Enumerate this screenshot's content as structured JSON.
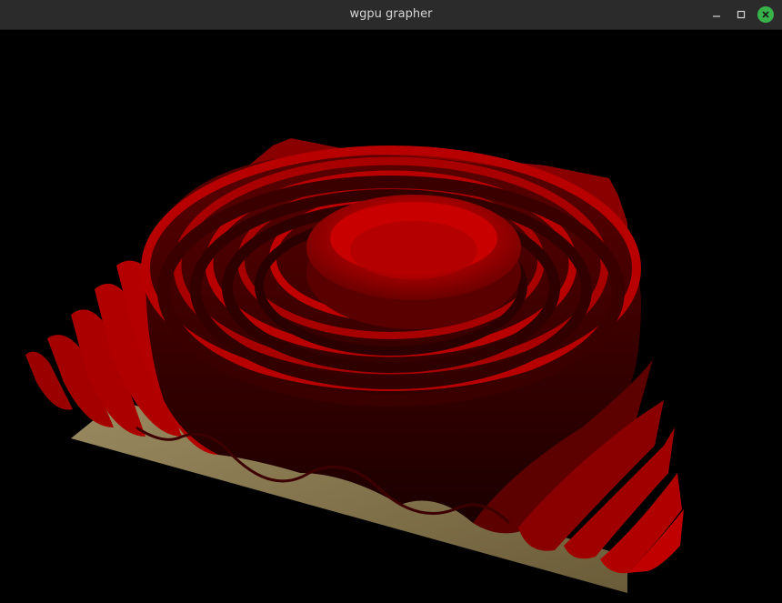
{
  "window": {
    "title": "wgpu grapher",
    "controls": {
      "minimize_icon": "minimize-icon",
      "maximize_icon": "maximize-icon",
      "close_icon": "close-icon"
    },
    "colors": {
      "titlebar": "#2b2b2b",
      "close_button": "#37b34a"
    }
  },
  "scene": {
    "background": "#000000",
    "surface_color": "#b00000",
    "floor_color": "#8a7a50",
    "description_icon": "3d-surface-plot"
  }
}
